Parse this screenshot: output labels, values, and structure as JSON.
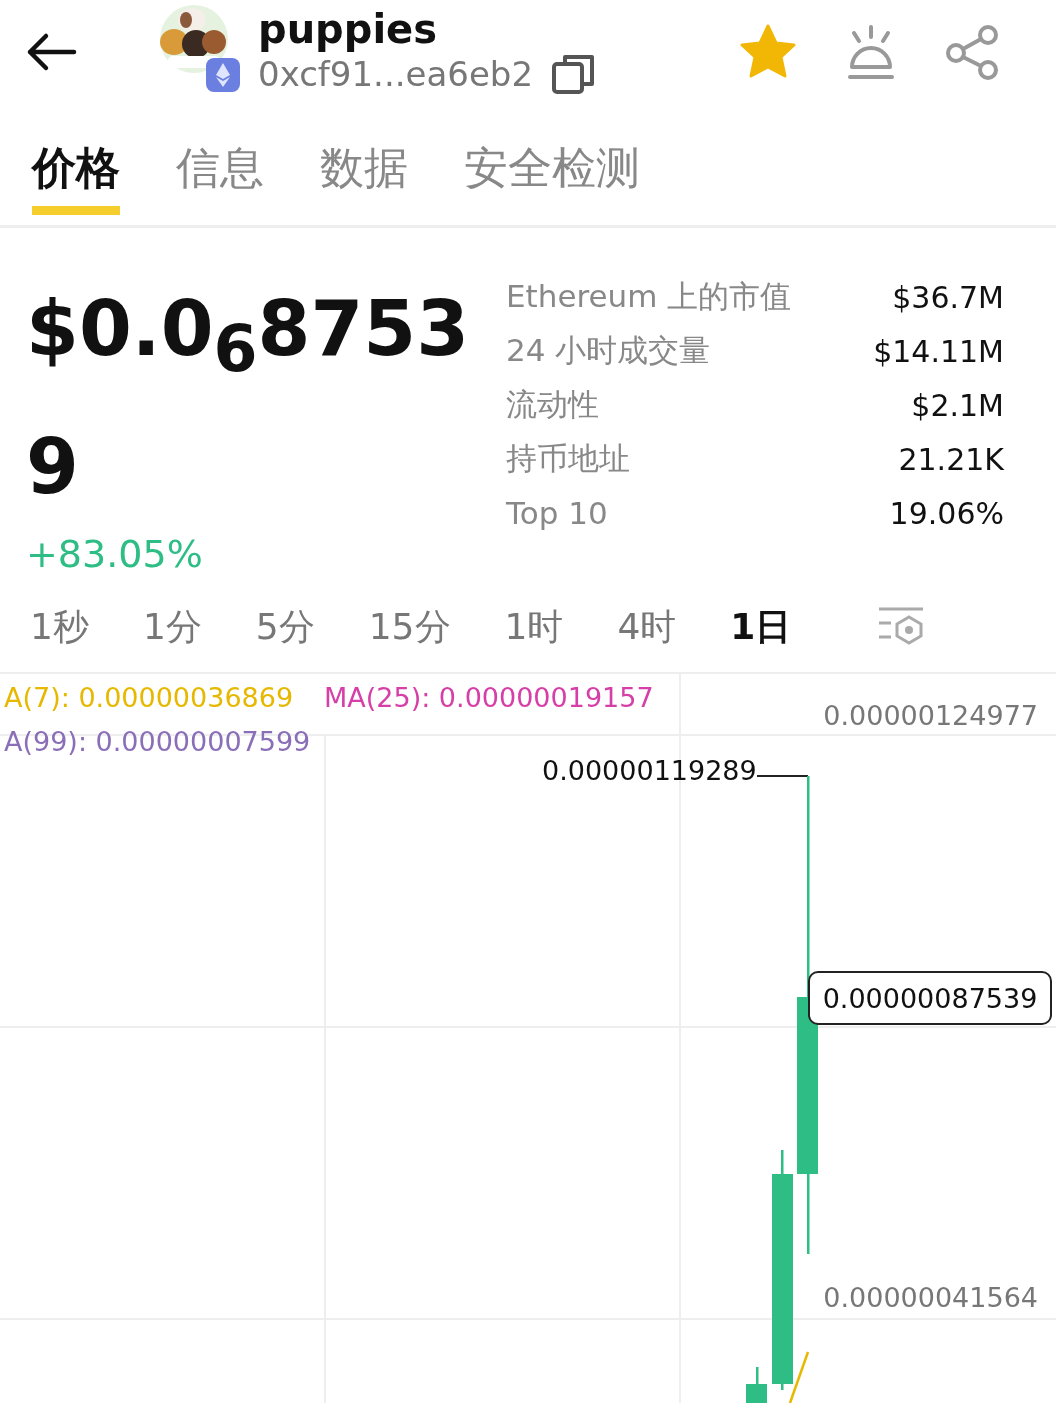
{
  "header": {
    "title": "puppies",
    "address": "0xcf91...ea6eb2",
    "favorited": true
  },
  "tabs": [
    {
      "label": "价格",
      "selected": true
    },
    {
      "label": "信息",
      "selected": false
    },
    {
      "label": "数据",
      "selected": false
    },
    {
      "label": "安全检测",
      "selected": false
    }
  ],
  "price": {
    "value": "$0.0$_{6}$87539",
    "change": "+83.05%"
  },
  "stats": [
    {
      "label": "Ethereum 上的市值",
      "value": "$36.7M"
    },
    {
      "label": "24 小时成交量",
      "value": "$14.11M"
    },
    {
      "label": "流动性",
      "value": "$2.1M"
    },
    {
      "label": "持币地址",
      "value": "21.21K"
    },
    {
      "label": "Top 10",
      "value": "19.06%"
    }
  ],
  "intervals": [
    {
      "label": "1秒",
      "selected": false
    },
    {
      "label": "1分",
      "selected": false
    },
    {
      "label": "5分",
      "selected": false
    },
    {
      "label": "15分",
      "selected": false
    },
    {
      "label": "1时",
      "selected": false
    },
    {
      "label": "4时",
      "selected": false
    },
    {
      "label": "1日",
      "selected": true
    }
  ],
  "chart": {
    "indicators": [
      {
        "text": "A(7): 0.00000036869",
        "color": "#e6b800"
      },
      {
        "text": "MA(25): 0.00000019157",
        "color": "#d63fa8"
      },
      {
        "text": "A(99): 0.00000007599",
        "color": "#8a6fb8"
      }
    ],
    "axis_labels": [
      "0.00000124977",
      "0.00000041564"
    ],
    "high_label": "0.00000119289",
    "current_price": "0.00000087539"
  }
}
